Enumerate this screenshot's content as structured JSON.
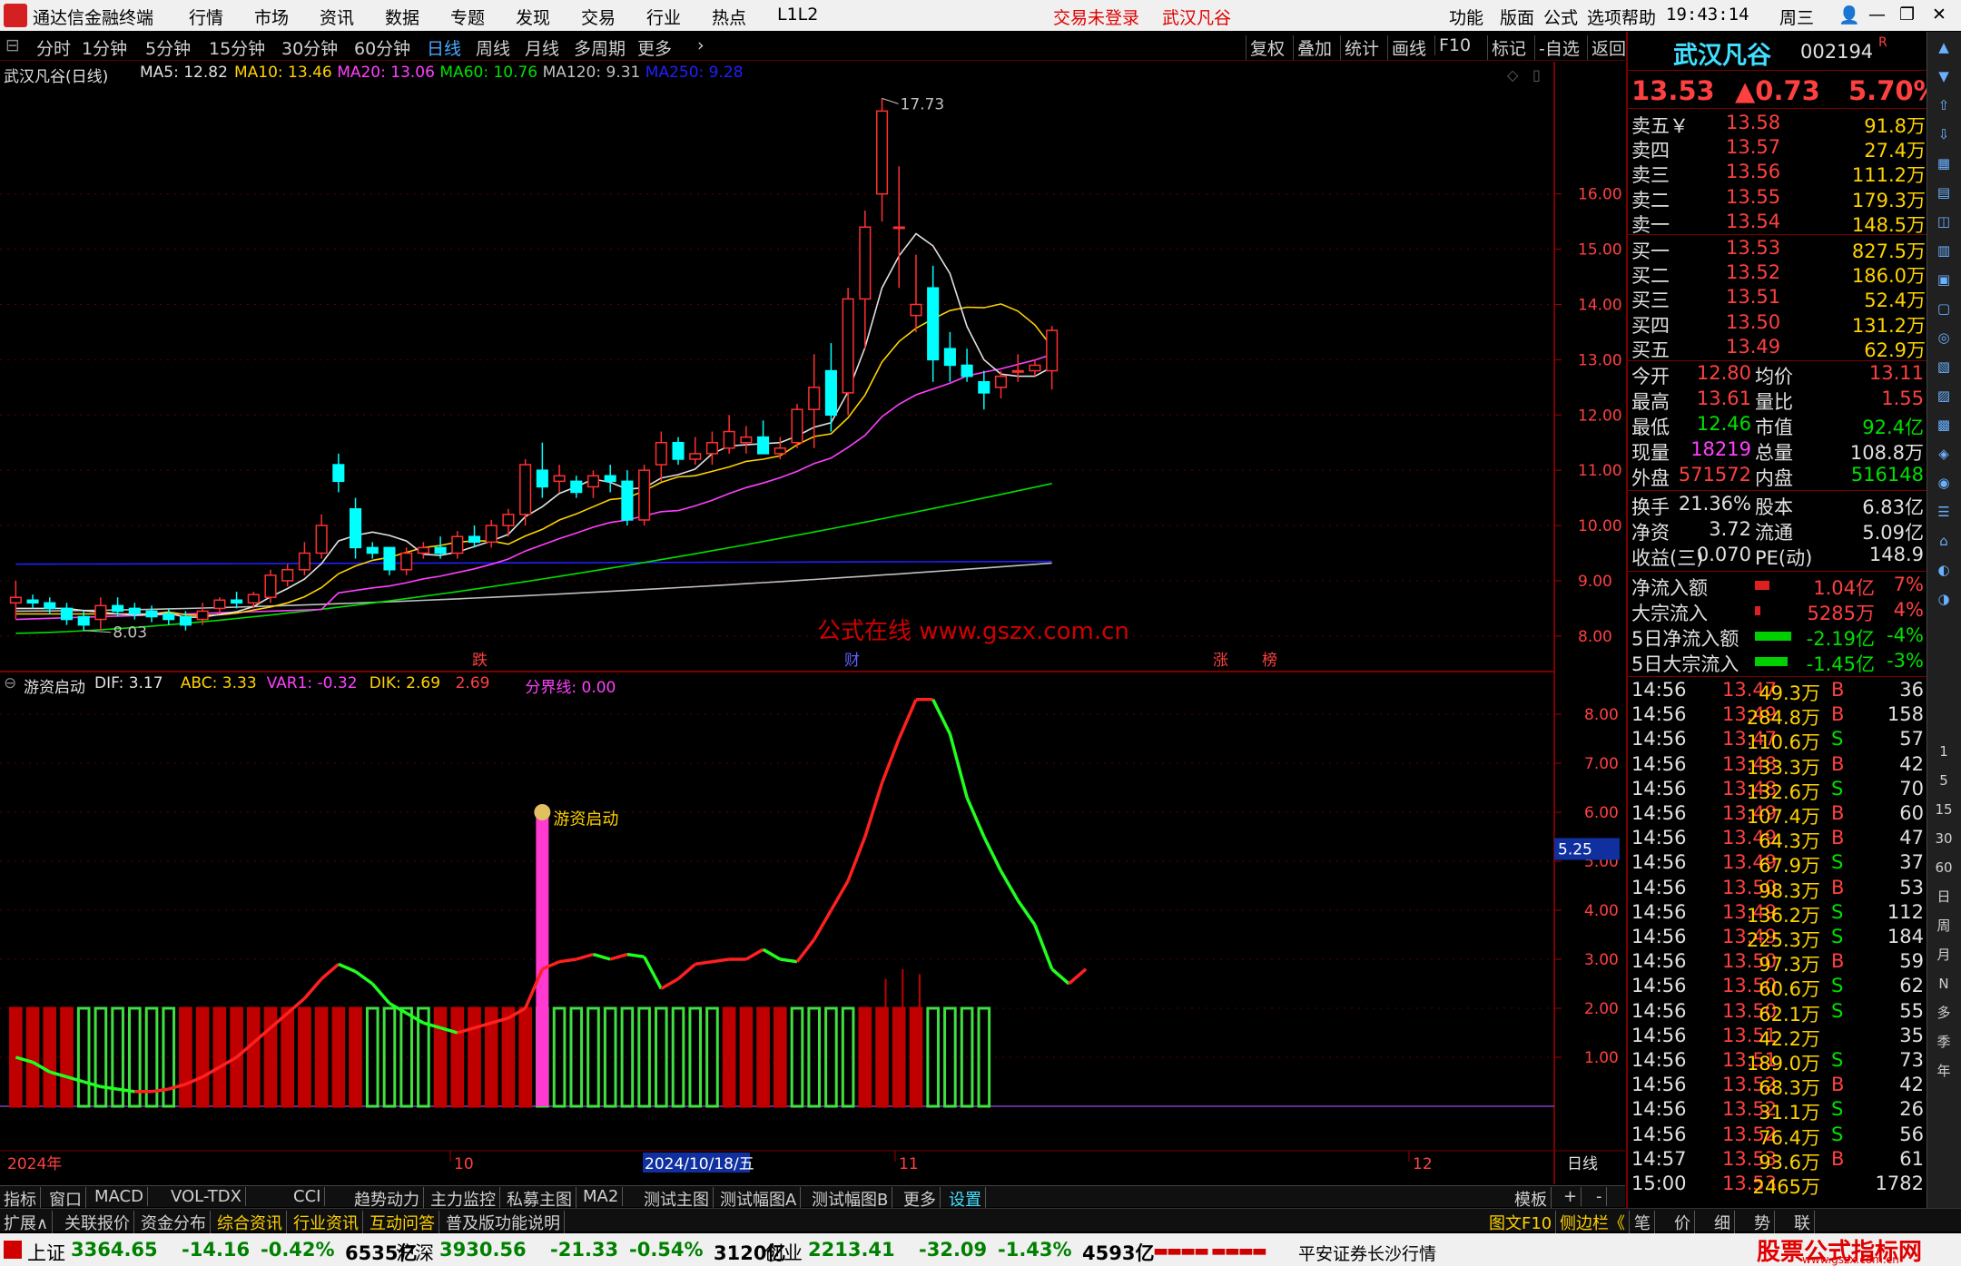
{
  "app": {
    "title": "通达信金融终端",
    "menus": [
      "行情",
      "市场",
      "资讯",
      "数据",
      "专题",
      "发现",
      "交易",
      "行业",
      "热点",
      "L1L2"
    ],
    "login_status": "交易未登录",
    "stock_tab": "武汉凡谷",
    "right_menus": [
      "功能",
      "版面",
      "公式",
      "选项",
      "帮助"
    ],
    "time": "19:43:14",
    "weekday": "周三"
  },
  "periods": {
    "items": [
      "分时",
      "1分钟",
      "5分钟",
      "15分钟",
      "30分钟",
      "60分钟",
      "日线",
      "周线",
      "月线",
      "多周期",
      "更多"
    ],
    "active": "日线",
    "tools": [
      "复权",
      "叠加",
      "统计",
      "画线",
      "F10",
      "标记",
      "-自选",
      "返回"
    ]
  },
  "main_chart": {
    "title": "武汉凡谷(日线)",
    "ma": [
      {
        "label": "MA5: 12.82",
        "color": "#e0e0e0"
      },
      {
        "label": "MA10: 13.46",
        "color": "#ffd200"
      },
      {
        "label": "MA20: 13.06",
        "color": "#ff40ff"
      },
      {
        "label": "MA60: 10.76",
        "color": "#00e000"
      },
      {
        "label": "MA120: 9.31",
        "color": "#c0c0c0"
      },
      {
        "label": "MA250: 9.28",
        "color": "#2020ff"
      }
    ],
    "y_ticks": [
      "16.00",
      "15.00",
      "14.00",
      "13.00",
      "12.00",
      "11.00",
      "10.00",
      "9.00",
      "8.00"
    ],
    "high_label": "17.73",
    "low_label": "8.03",
    "watermark": "公式在线 www.gszx.com.cn",
    "event_tags": [
      "跌",
      "财",
      "涨",
      "榜"
    ]
  },
  "chart_data": [
    {
      "type": "candlestick",
      "title": "武汉凡谷(日线)",
      "ylim": [
        7.8,
        17.9
      ],
      "candles": [
        [
          8.6,
          9.0,
          8.3,
          8.7
        ],
        [
          8.65,
          8.75,
          8.5,
          8.6
        ],
        [
          8.6,
          8.7,
          8.4,
          8.5
        ],
        [
          8.5,
          8.6,
          8.2,
          8.3
        ],
        [
          8.35,
          8.45,
          8.1,
          8.2
        ],
        [
          8.3,
          8.7,
          8.1,
          8.55
        ],
        [
          8.55,
          8.7,
          8.35,
          8.45
        ],
        [
          8.5,
          8.6,
          8.3,
          8.4
        ],
        [
          8.45,
          8.55,
          8.25,
          8.35
        ],
        [
          8.4,
          8.5,
          8.2,
          8.3
        ],
        [
          8.35,
          8.45,
          8.1,
          8.2
        ],
        [
          8.3,
          8.6,
          8.2,
          8.45
        ],
        [
          8.5,
          8.7,
          8.4,
          8.65
        ],
        [
          8.65,
          8.8,
          8.5,
          8.6
        ],
        [
          8.6,
          8.8,
          8.5,
          8.75
        ],
        [
          8.7,
          9.2,
          8.6,
          9.1
        ],
        [
          9.0,
          9.3,
          8.9,
          9.2
        ],
        [
          9.2,
          9.7,
          9.1,
          9.5
        ],
        [
          9.5,
          10.2,
          9.4,
          10.0
        ],
        [
          11.1,
          11.3,
          10.6,
          10.8
        ],
        [
          10.3,
          10.5,
          9.4,
          9.6
        ],
        [
          9.6,
          9.7,
          9.4,
          9.5
        ],
        [
          9.6,
          9.6,
          9.1,
          9.2
        ],
        [
          9.2,
          9.6,
          9.1,
          9.5
        ],
        [
          9.5,
          9.7,
          9.4,
          9.6
        ],
        [
          9.6,
          9.8,
          9.4,
          9.5
        ],
        [
          9.5,
          9.9,
          9.4,
          9.8
        ],
        [
          9.8,
          10.0,
          9.6,
          9.7
        ],
        [
          9.7,
          10.1,
          9.6,
          10.0
        ],
        [
          10.0,
          10.3,
          9.8,
          10.2
        ],
        [
          10.2,
          11.2,
          10.0,
          11.1
        ],
        [
          11.0,
          11.5,
          10.5,
          10.7
        ],
        [
          10.8,
          11.1,
          10.6,
          10.9
        ],
        [
          10.8,
          10.9,
          10.5,
          10.6
        ],
        [
          10.7,
          11.0,
          10.5,
          10.9
        ],
        [
          10.9,
          11.1,
          10.6,
          10.8
        ],
        [
          10.8,
          11.0,
          10.0,
          10.1
        ],
        [
          10.1,
          11.1,
          10.0,
          11.0
        ],
        [
          11.1,
          11.7,
          10.8,
          11.5
        ],
        [
          11.5,
          11.6,
          11.1,
          11.2
        ],
        [
          11.2,
          11.6,
          11.1,
          11.3
        ],
        [
          11.3,
          11.7,
          11.1,
          11.5
        ],
        [
          11.4,
          12.0,
          11.3,
          11.7
        ],
        [
          11.5,
          11.8,
          11.3,
          11.6
        ],
        [
          11.6,
          11.9,
          11.4,
          11.3
        ],
        [
          11.3,
          11.6,
          11.2,
          11.4
        ],
        [
          11.5,
          12.2,
          11.4,
          12.1
        ],
        [
          12.1,
          13.1,
          11.4,
          12.5
        ],
        [
          12.8,
          13.3,
          11.7,
          12.0
        ],
        [
          12.4,
          14.3,
          12.0,
          14.1
        ],
        [
          14.1,
          15.7,
          13.2,
          15.4
        ],
        [
          16.0,
          17.73,
          15.5,
          17.5
        ],
        [
          15.4,
          16.5,
          14.3,
          15.4
        ],
        [
          13.8,
          14.9,
          13.5,
          14.0
        ],
        [
          14.3,
          14.7,
          12.6,
          13.0
        ],
        [
          13.2,
          13.5,
          12.6,
          12.9
        ],
        [
          12.9,
          13.2,
          12.6,
          12.7
        ],
        [
          12.6,
          12.8,
          12.1,
          12.4
        ],
        [
          12.5,
          12.8,
          12.3,
          12.7
        ],
        [
          12.8,
          13.1,
          12.6,
          12.8
        ],
        [
          12.8,
          13.0,
          12.7,
          12.9
        ],
        [
          12.8,
          13.61,
          12.46,
          13.53
        ]
      ]
    },
    {
      "type": "line",
      "title": "游资启动",
      "x": [
        "2024年",
        "10",
        "2024/10/18/五",
        "11",
        "12"
      ],
      "series": [
        {
          "name": "DIF",
          "values": [
            1.0,
            0.9,
            0.7,
            0.6,
            0.5,
            0.4,
            0.35,
            0.3,
            0.3,
            0.35,
            0.45,
            0.6,
            0.8,
            1.0,
            1.3,
            1.6,
            1.9,
            2.2,
            2.6,
            2.9,
            2.75,
            2.5,
            2.1,
            1.9,
            1.7,
            1.6,
            1.5,
            1.6,
            1.7,
            1.8,
            2.0,
            2.8,
            2.95,
            3.0,
            3.1,
            3.0,
            3.1,
            3.05,
            2.4,
            2.6,
            2.9,
            2.95,
            3.0,
            3.0,
            3.2,
            3.0,
            2.95,
            3.4,
            4.0,
            4.6,
            5.5,
            6.6,
            7.5,
            8.3,
            8.3,
            7.6,
            6.3,
            5.5,
            4.8,
            4.2,
            3.7,
            2.8,
            2.5,
            2.8
          ]
        }
      ],
      "annotations": [
        "DIF: 3.17",
        "ABC: 3.33",
        "VAR1: -0.32",
        "DIK: 2.69",
        "2.69",
        "分界线: 0.00"
      ],
      "ylim": [
        -0.5,
        8.5
      ]
    }
  ],
  "sub_chart": {
    "indicator": "游资启动",
    "values": [
      {
        "label": "DIF: 3.17",
        "color": "#e0e0e0"
      },
      {
        "label": "ABC: 3.33",
        "color": "#ffd200"
      },
      {
        "label": "VAR1: -0.32",
        "color": "#ff40ff"
      },
      {
        "label": "DIK: 2.69",
        "color": "#ffd200"
      },
      {
        "label": "2.69",
        "color": "#ff4040"
      },
      {
        "label": "分界线: 0.00",
        "color": "#ff40ff"
      }
    ],
    "y_ticks": [
      "8.00",
      "7.00",
      "6.00",
      "5.00",
      "4.00",
      "3.00",
      "2.00",
      "1.00"
    ],
    "current_tag": "5.25",
    "signal_label": "游资启动",
    "x_labels": [
      "2024年",
      "10",
      "2024/10/18/五",
      "11",
      "12"
    ],
    "period_label": "日线"
  },
  "quote": {
    "name": "武汉凡谷",
    "code": "002194",
    "flag": "R",
    "price": "13.53",
    "change": "▲0.73",
    "pct": "5.70%",
    "asks": [
      {
        "lbl": "卖五￥",
        "p": "13.58",
        "v": "91.8万"
      },
      {
        "lbl": "卖四",
        "p": "13.57",
        "v": "27.4万"
      },
      {
        "lbl": "卖三",
        "p": "13.56",
        "v": "111.2万"
      },
      {
        "lbl": "卖二",
        "p": "13.55",
        "v": "179.3万"
      },
      {
        "lbl": "卖一",
        "p": "13.54",
        "v": "148.5万"
      }
    ],
    "bids": [
      {
        "lbl": "买一",
        "p": "13.53",
        "v": "827.5万"
      },
      {
        "lbl": "买二",
        "p": "13.52",
        "v": "186.0万"
      },
      {
        "lbl": "买三",
        "p": "13.51",
        "v": "52.4万"
      },
      {
        "lbl": "买四",
        "p": "13.50",
        "v": "131.2万"
      },
      {
        "lbl": "买五",
        "p": "13.49",
        "v": "62.9万"
      }
    ],
    "stats": [
      {
        "a": "今开",
        "av": "12.80",
        "b": "均价",
        "bv": "13.11"
      },
      {
        "a": "最高",
        "av": "13.61",
        "b": "量比",
        "bv": "1.55"
      },
      {
        "a": "最低",
        "av": "12.46",
        "b": "市值",
        "bv": "92.4亿"
      },
      {
        "a": "现量",
        "av": "18219",
        "b": "总量",
        "bv": "108.8万"
      },
      {
        "a": "外盘",
        "av": "571572",
        "b": "内盘",
        "bv": "516148"
      }
    ],
    "stats2": [
      {
        "a": "换手",
        "av": "21.36%",
        "b": "股本",
        "bv": "6.83亿"
      },
      {
        "a": "净资",
        "av": "3.72",
        "b": "流通",
        "bv": "5.09亿"
      },
      {
        "a": "收益(三)",
        "av": "0.070",
        "b": "PE(动)",
        "bv": "148.9"
      }
    ],
    "flows": [
      {
        "a": "净流入额",
        "v": "1.04亿",
        "p": "7%"
      },
      {
        "a": "大宗流入",
        "v": "5285万",
        "p": "4%"
      },
      {
        "a": "5日净流入额",
        "v": "-2.19亿",
        "p": "-4%"
      },
      {
        "a": "5日大宗流入",
        "v": "-1.45亿",
        "p": "-3%"
      }
    ],
    "ticks": [
      [
        "14:56",
        "13.47",
        "49.3万",
        "B",
        "36"
      ],
      [
        "14:56",
        "13.49",
        "284.8万",
        "B",
        "158"
      ],
      [
        "14:56",
        "13.47",
        "110.6万",
        "S",
        "57"
      ],
      [
        "14:56",
        "13.48",
        "133.3万",
        "B",
        "42"
      ],
      [
        "14:56",
        "13.48",
        "132.6万",
        "S",
        "70"
      ],
      [
        "14:56",
        "13.49",
        "107.4万",
        "B",
        "60"
      ],
      [
        "14:56",
        "13.49",
        "64.3万",
        "B",
        "47"
      ],
      [
        "14:56",
        "13.49",
        "67.9万",
        "S",
        "37"
      ],
      [
        "14:56",
        "13.50",
        "98.3万",
        "B",
        "53"
      ],
      [
        "14:56",
        "13.49",
        "136.2万",
        "S",
        "112"
      ],
      [
        "14:56",
        "13.49",
        "225.3万",
        "S",
        "184"
      ],
      [
        "14:56",
        "13.50",
        "97.3万",
        "B",
        "59"
      ],
      [
        "14:56",
        "13.50",
        "60.6万",
        "S",
        "62"
      ],
      [
        "14:56",
        "13.50",
        "62.1万",
        "S",
        "55"
      ],
      [
        "14:56",
        "13.51",
        "42.2万",
        "",
        "35"
      ],
      [
        "14:56",
        "13.51",
        "189.0万",
        "S",
        "73"
      ],
      [
        "14:56",
        "13.52",
        "68.3万",
        "B",
        "42"
      ],
      [
        "14:56",
        "13.52",
        "31.1万",
        "S",
        "26"
      ],
      [
        "14:56",
        "13.52",
        "76.4万",
        "S",
        "56"
      ],
      [
        "14:57",
        "13.53",
        "93.6万",
        "B",
        "61"
      ],
      [
        "15:00",
        "13.53",
        "2465万",
        "",
        "1782"
      ]
    ]
  },
  "sidebar": [
    "N",
    "月",
    "季",
    "年",
    "日",
    "周",
    "月",
    "N",
    "多",
    "季",
    "年",
    "1",
    "5",
    "15",
    "30",
    "60"
  ],
  "bottom1": [
    "指标",
    "窗口",
    "MACD",
    "VOL-TDX",
    "CCI",
    "趋势动力",
    "主力监控",
    "私募主图",
    "MA2",
    "测试主图",
    "测试幅图A",
    "测试幅图B",
    "更多",
    "设置",
    "模板",
    "+",
    "-"
  ],
  "bottom2": [
    "扩展∧",
    "关联报价",
    "资金分布",
    "综合资讯",
    "行业资讯",
    "互动问答",
    "普及版功能说明",
    "图文F10",
    "侧边栏《",
    "笔",
    "价",
    "细",
    "势",
    "联"
  ],
  "status": {
    "items": [
      {
        "name": "上证",
        "v": "3364.65",
        "c": "-14.16",
        "p": "-0.42%",
        "amt": "6535亿"
      },
      {
        "name": "沪深",
        "v": "3930.56",
        "c": "-21.33",
        "p": "-0.54%",
        "amt": "3120亿"
      },
      {
        "name": "创业",
        "v": "2213.41",
        "c": "-32.09",
        "p": "-1.43%",
        "amt": "4593亿"
      }
    ],
    "broker": "平安证券长沙行情",
    "brand": "股票公式指标网",
    "brand_url": "www.gszx.com.cn"
  }
}
